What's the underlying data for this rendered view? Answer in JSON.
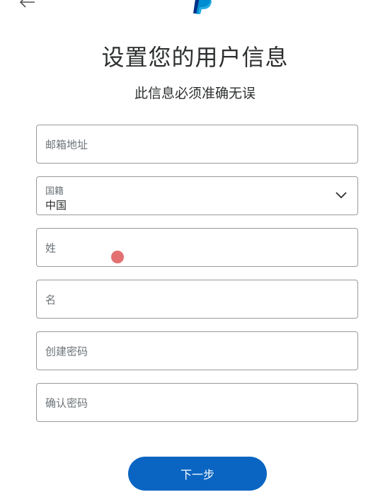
{
  "header": {
    "back_icon": "arrow-left-icon",
    "logo_icon": "paypal-logo-icon",
    "brand_color": "#003087",
    "brand_color_light": "#009cde"
  },
  "title": "设置您的用户信息",
  "subtitle": "此信息必须准确无误",
  "form": {
    "email_placeholder": "邮箱地址",
    "nationality_label": "国籍",
    "nationality_value": "中国",
    "last_name_placeholder": "姓",
    "first_name_placeholder": "名",
    "create_password_placeholder": "创建密码",
    "confirm_password_placeholder": "确认密码"
  },
  "next_button_label": "下一步",
  "colors": {
    "primary_button": "#0a65c2",
    "input_border": "#9a9a9a",
    "placeholder": "#6c7378",
    "text": "#2c2e2f"
  }
}
